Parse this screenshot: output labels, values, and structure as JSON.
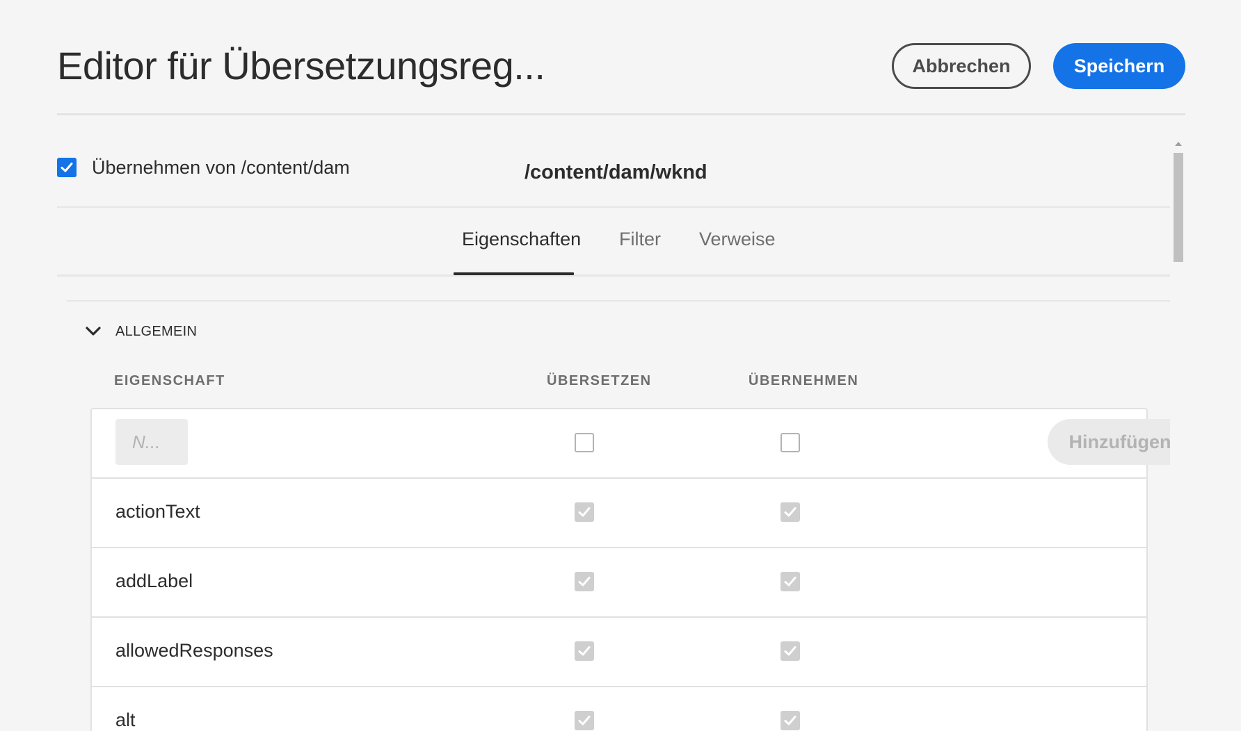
{
  "header": {
    "title": "Editor für Übersetzungsreg...",
    "cancel_label": "Abbrechen",
    "save_label": "Speichern"
  },
  "inherit": {
    "checked": true,
    "label": "Übernehmen von /content/dam",
    "path": "/content/dam/wknd"
  },
  "tabs": [
    {
      "label": "Eigenschaften",
      "active": true
    },
    {
      "label": "Filter",
      "active": false
    },
    {
      "label": "Verweise",
      "active": false
    }
  ],
  "section": {
    "title": "ALLGEMEIN",
    "expanded": true
  },
  "table": {
    "columns": [
      "EIGENSCHAFT",
      "ÜBERSETZEN",
      "ÜBERNEHMEN"
    ],
    "new_row": {
      "placeholder": "N...",
      "translate_checked": false,
      "inherit_checked": false,
      "add_label": "Hinzufügen"
    },
    "rows": [
      {
        "name": "actionText",
        "translate": true,
        "inherit": true
      },
      {
        "name": "addLabel",
        "translate": true,
        "inherit": true
      },
      {
        "name": "allowedResponses",
        "translate": true,
        "inherit": true
      },
      {
        "name": "alt",
        "translate": true,
        "inherit": true
      }
    ]
  },
  "colors": {
    "accent": "#1473e6",
    "background": "#f5f5f5",
    "text": "#2c2c2c",
    "muted_text": "#6e6e6e",
    "disabled_checkbox": "#cfcfcf"
  }
}
